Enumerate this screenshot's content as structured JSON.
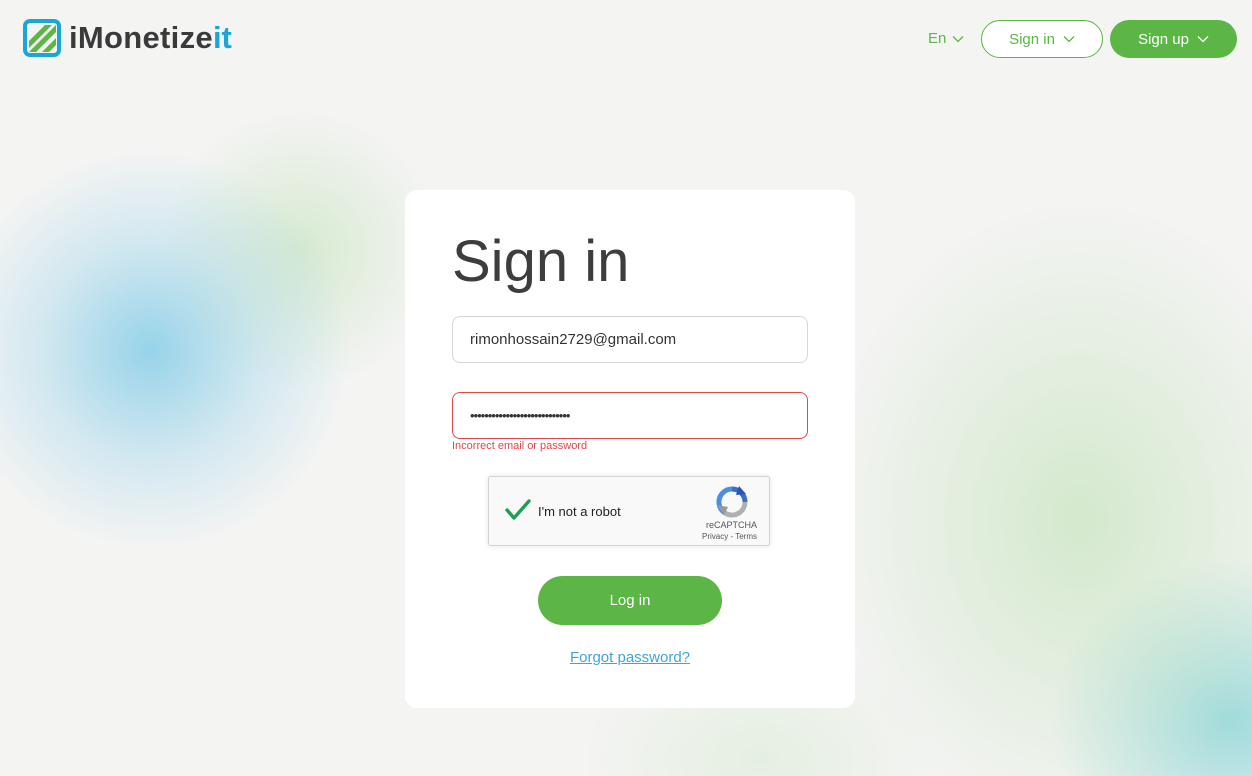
{
  "header": {
    "logo_text": "iMonetize",
    "logo_accent": "it",
    "language": "En",
    "signin_label": "Sign in",
    "signup_label": "Sign up"
  },
  "form": {
    "title": "Sign in",
    "email_value": "rimonhossain2729@gmail.com",
    "password_value": "••••••••••••••••••••••••••••",
    "error": "Incorrect email or password",
    "login_label": "Log in",
    "forgot_label": "Forgot password?"
  },
  "captcha": {
    "label": "I'm not a robot",
    "brand": "reCAPTCHA",
    "links": "Privacy - Terms",
    "checked": true
  },
  "colors": {
    "accent_green": "#5cb646",
    "accent_blue": "#1aa7d8",
    "error_red": "#e0474c",
    "link_blue": "#3ea5d8"
  },
  "icons": [
    "logo-mark-icon",
    "chevron-down-icon",
    "checkmark-icon",
    "recaptcha-icon"
  ]
}
